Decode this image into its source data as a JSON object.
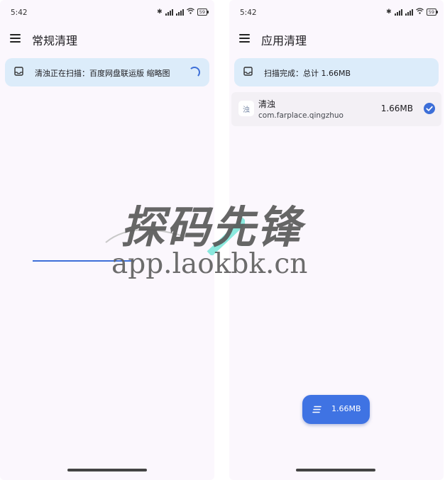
{
  "left_screen": {
    "status": {
      "time": "5:42",
      "battery": "59"
    },
    "title": "常规清理",
    "card_text": "清浊正在扫描：百度网盘联运版 缩略图"
  },
  "right_screen": {
    "status": {
      "time": "5:42",
      "battery": "59"
    },
    "title": "应用清理",
    "card_text": "扫描完成：总计 1.66MB",
    "app": {
      "icon_text": "浊",
      "name": "清浊",
      "package": "com.farplace.qingzhuo",
      "size": "1.66MB",
      "checked": true
    },
    "fab_label": "1.66MB"
  },
  "watermark": {
    "chinese": "探码先锋",
    "url": "app.laokbk.cn"
  },
  "colors": {
    "accent": "#3f73e3",
    "card_bg": "#dcecfa",
    "screen_bg": "#fbf7fd"
  }
}
